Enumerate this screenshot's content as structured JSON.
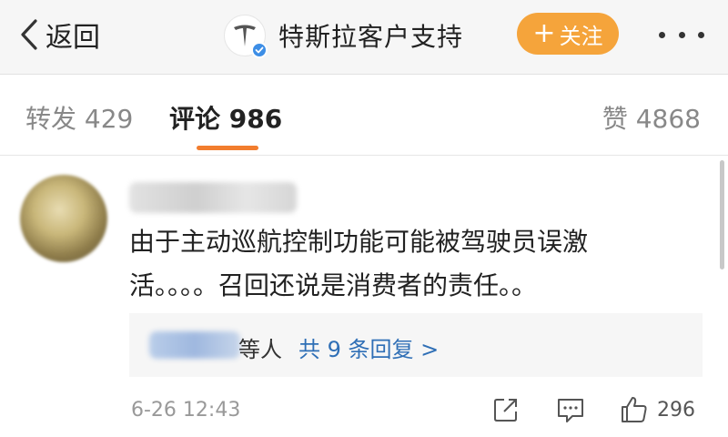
{
  "header": {
    "back_label": "返回",
    "account_name": "特斯拉客户支持",
    "follow_label": "关注",
    "follow_plus": "+"
  },
  "tabs": {
    "repost": "转发 429",
    "comment": "评论 986",
    "like": "赞 4868"
  },
  "comment": {
    "text": "由于主动巡航控制功能可能被驾驶员误激活。。。。召回还说是消费者的责任。。",
    "reply_suffix": "等人",
    "reply_link": "共 9 条回复 >",
    "time": "6-26 12:43",
    "like_count": "296"
  },
  "colors": {
    "accent_orange": "#f5a43b",
    "tab_underline": "#f27d2e",
    "link_blue": "#2f6fb6",
    "verified_blue": "#3d8ee6"
  },
  "icons": [
    "chevron-left-icon",
    "tesla-logo-icon",
    "verified-badge-icon",
    "more-dots-icon",
    "share-icon",
    "comment-icon",
    "thumbs-up-icon"
  ]
}
